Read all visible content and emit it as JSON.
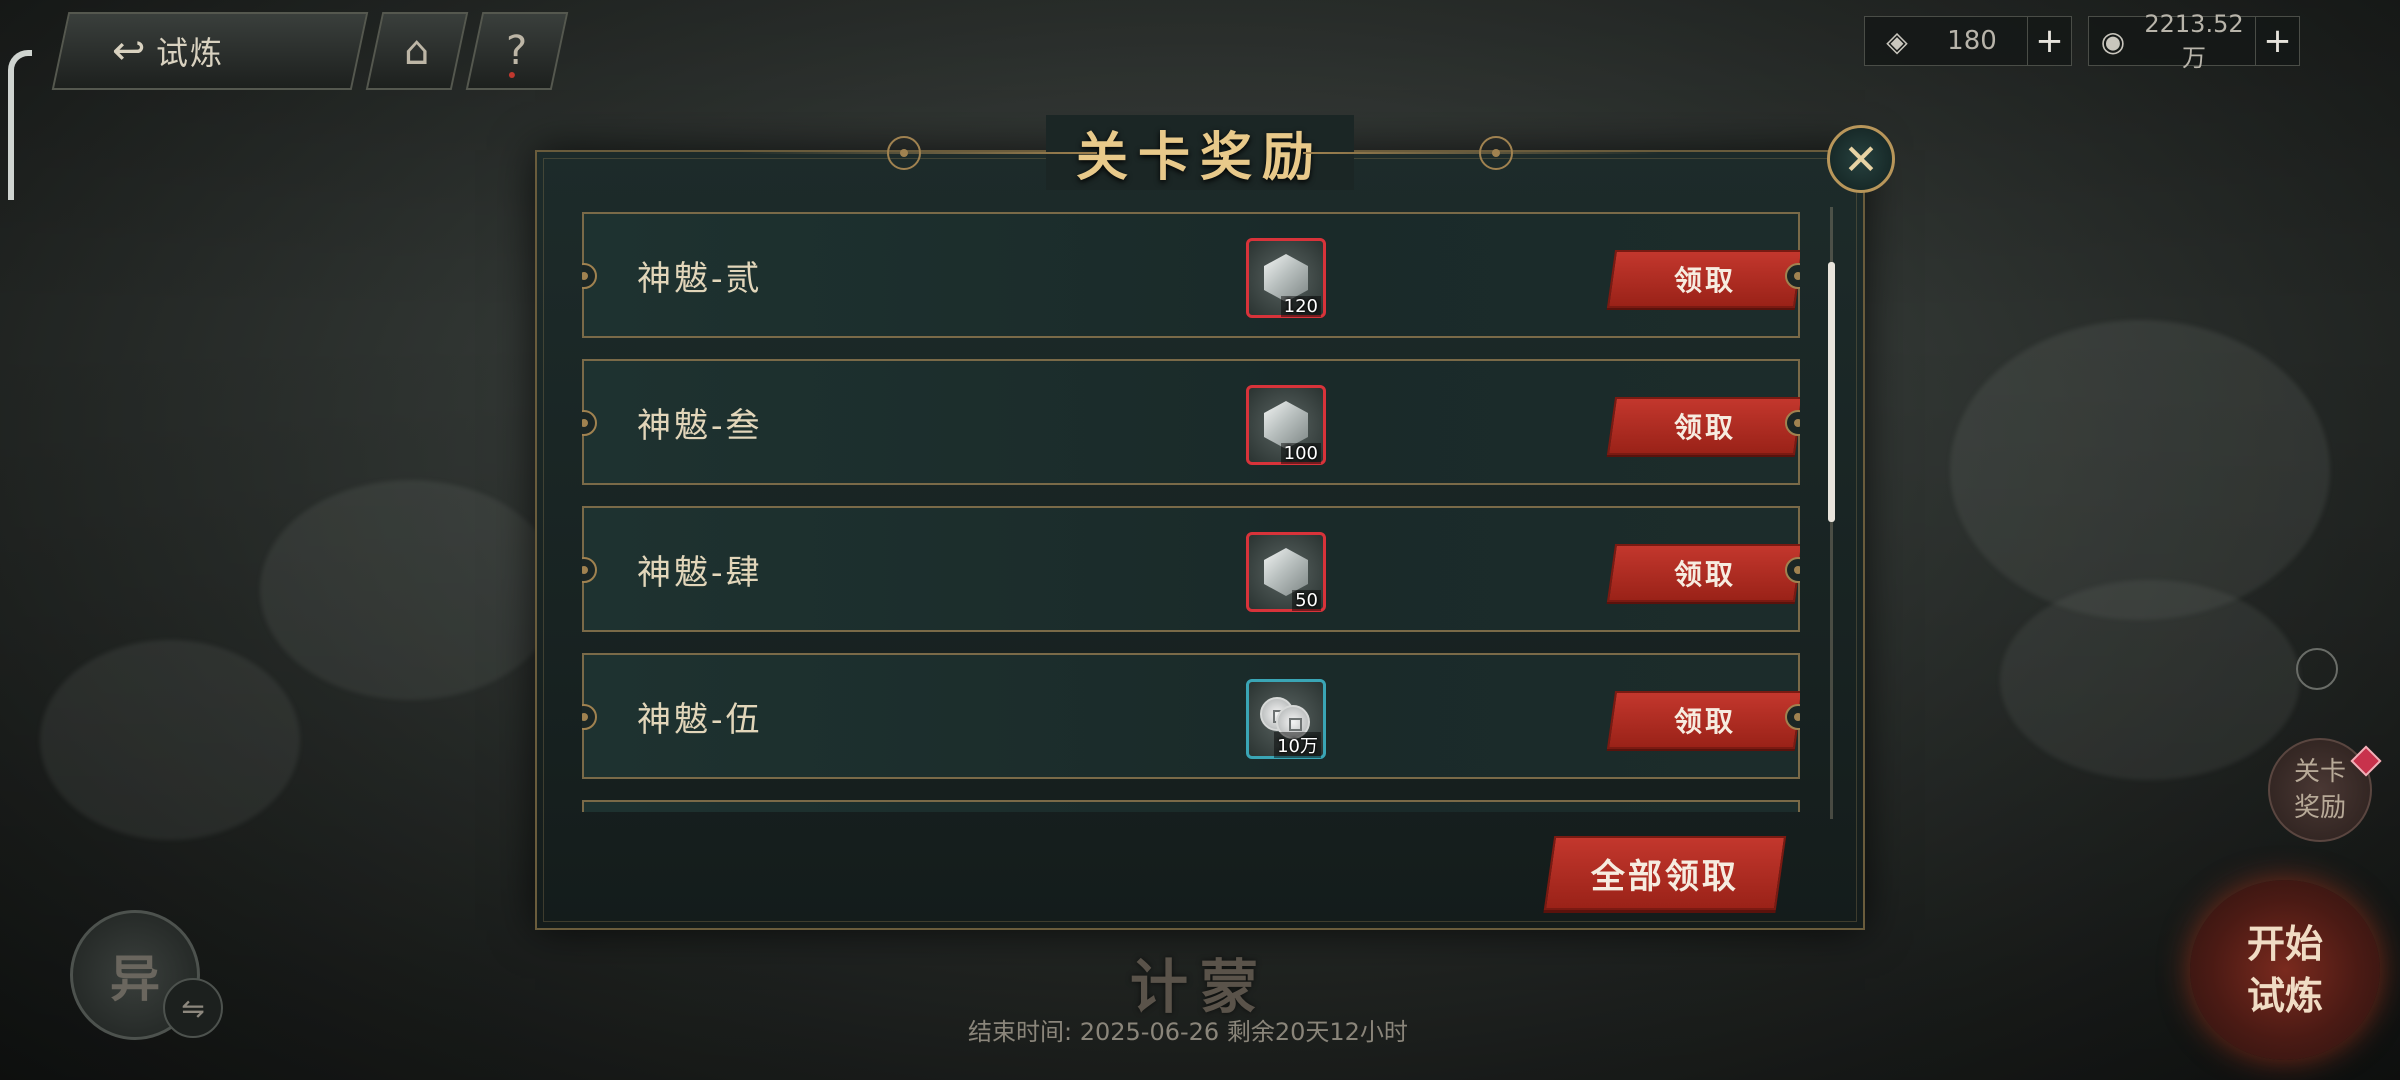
{
  "topbar": {
    "back_label": "试炼",
    "back_icon": "↩",
    "home_icon": "⌂",
    "help_icon": "?"
  },
  "currencies": [
    {
      "icon": "jade-icon",
      "glyph": "◈",
      "value": "180",
      "plus": "+"
    },
    {
      "icon": "coin-icon",
      "glyph": "◉",
      "value": "2213.52万",
      "plus": "+"
    }
  ],
  "dialog": {
    "title": "关卡奖励",
    "close_icon": "✕",
    "rows": [
      {
        "name": "神魃-贰",
        "reward_type": "gem",
        "qty": "120",
        "button": "领取"
      },
      {
        "name": "神魃-叁",
        "reward_type": "gem",
        "qty": "100",
        "button": "领取"
      },
      {
        "name": "神魃-肆",
        "reward_type": "gem",
        "qty": "50",
        "button": "领取"
      },
      {
        "name": "神魃-伍",
        "reward_type": "coin",
        "qty": "10万",
        "button": "领取"
      }
    ],
    "claim_all": "全部领取"
  },
  "stage": {
    "name": "计蒙",
    "end_time": "结束时间: 2025-06-26  剩余20天12小时"
  },
  "left_orb": {
    "label": "异",
    "swap_icon": "⇋"
  },
  "right_panel": {
    "reward_button": "关卡奖励",
    "start_button": "开始试炼"
  },
  "colors": {
    "accent_red": "#b52d22",
    "gold": "#a08250",
    "rare_border": "#d8333a",
    "teal_border": "#3aa5b5"
  }
}
